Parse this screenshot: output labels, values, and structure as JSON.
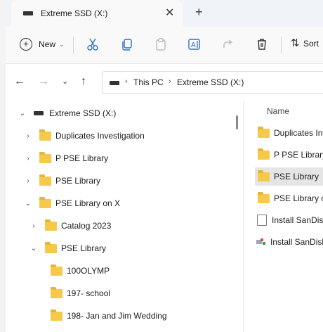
{
  "window": {
    "tab_title": "Extreme SSD (X:)",
    "new_tab_symbol": "+",
    "close_symbol": "✕"
  },
  "toolbar": {
    "new_label": "New",
    "sort_label": "Sort",
    "icons": [
      "cut-icon",
      "copy-icon",
      "paste-icon",
      "rename-icon",
      "share-icon",
      "delete-icon",
      "sort-icon"
    ]
  },
  "address_bar": {
    "crumbs": [
      "This PC",
      "Extreme SSD (X:)"
    ]
  },
  "tree": {
    "items": [
      {
        "label": "Extreme SSD (X:)",
        "expanded": true,
        "type": "drive"
      },
      {
        "label": "Duplicates Investigation",
        "expanded": false,
        "type": "folder"
      },
      {
        "label": "P PSE Library",
        "expanded": false,
        "type": "folder"
      },
      {
        "label": "PSE Library",
        "expanded": false,
        "type": "folder"
      },
      {
        "label": "PSE Library on X",
        "expanded": true,
        "type": "folder"
      },
      {
        "label": "Catalog 2023",
        "expanded": false,
        "type": "folder"
      },
      {
        "label": "PSE Library",
        "expanded": true,
        "type": "folder"
      },
      {
        "label": "100OLYMP",
        "type": "folder"
      },
      {
        "label": "197- school",
        "type": "folder"
      },
      {
        "label": "198- Jan and Jim Wedding",
        "type": "folder"
      }
    ]
  },
  "files": {
    "column_name": "Name",
    "items": [
      {
        "label": "Duplicates Inv",
        "type": "folder",
        "selected": false
      },
      {
        "label": "P PSE Library",
        "type": "folder",
        "selected": false
      },
      {
        "label": "PSE Library",
        "type": "folder",
        "selected": true
      },
      {
        "label": "PSE Library or",
        "type": "folder",
        "selected": false
      },
      {
        "label": "Install SanDisk",
        "type": "document",
        "selected": false
      },
      {
        "label": "Install SanDisk",
        "type": "application",
        "selected": false
      }
    ]
  },
  "colors": {
    "folder": "#f7c94a",
    "selection": "#e5e5e5",
    "tab_bar": "#f0f4f9"
  }
}
